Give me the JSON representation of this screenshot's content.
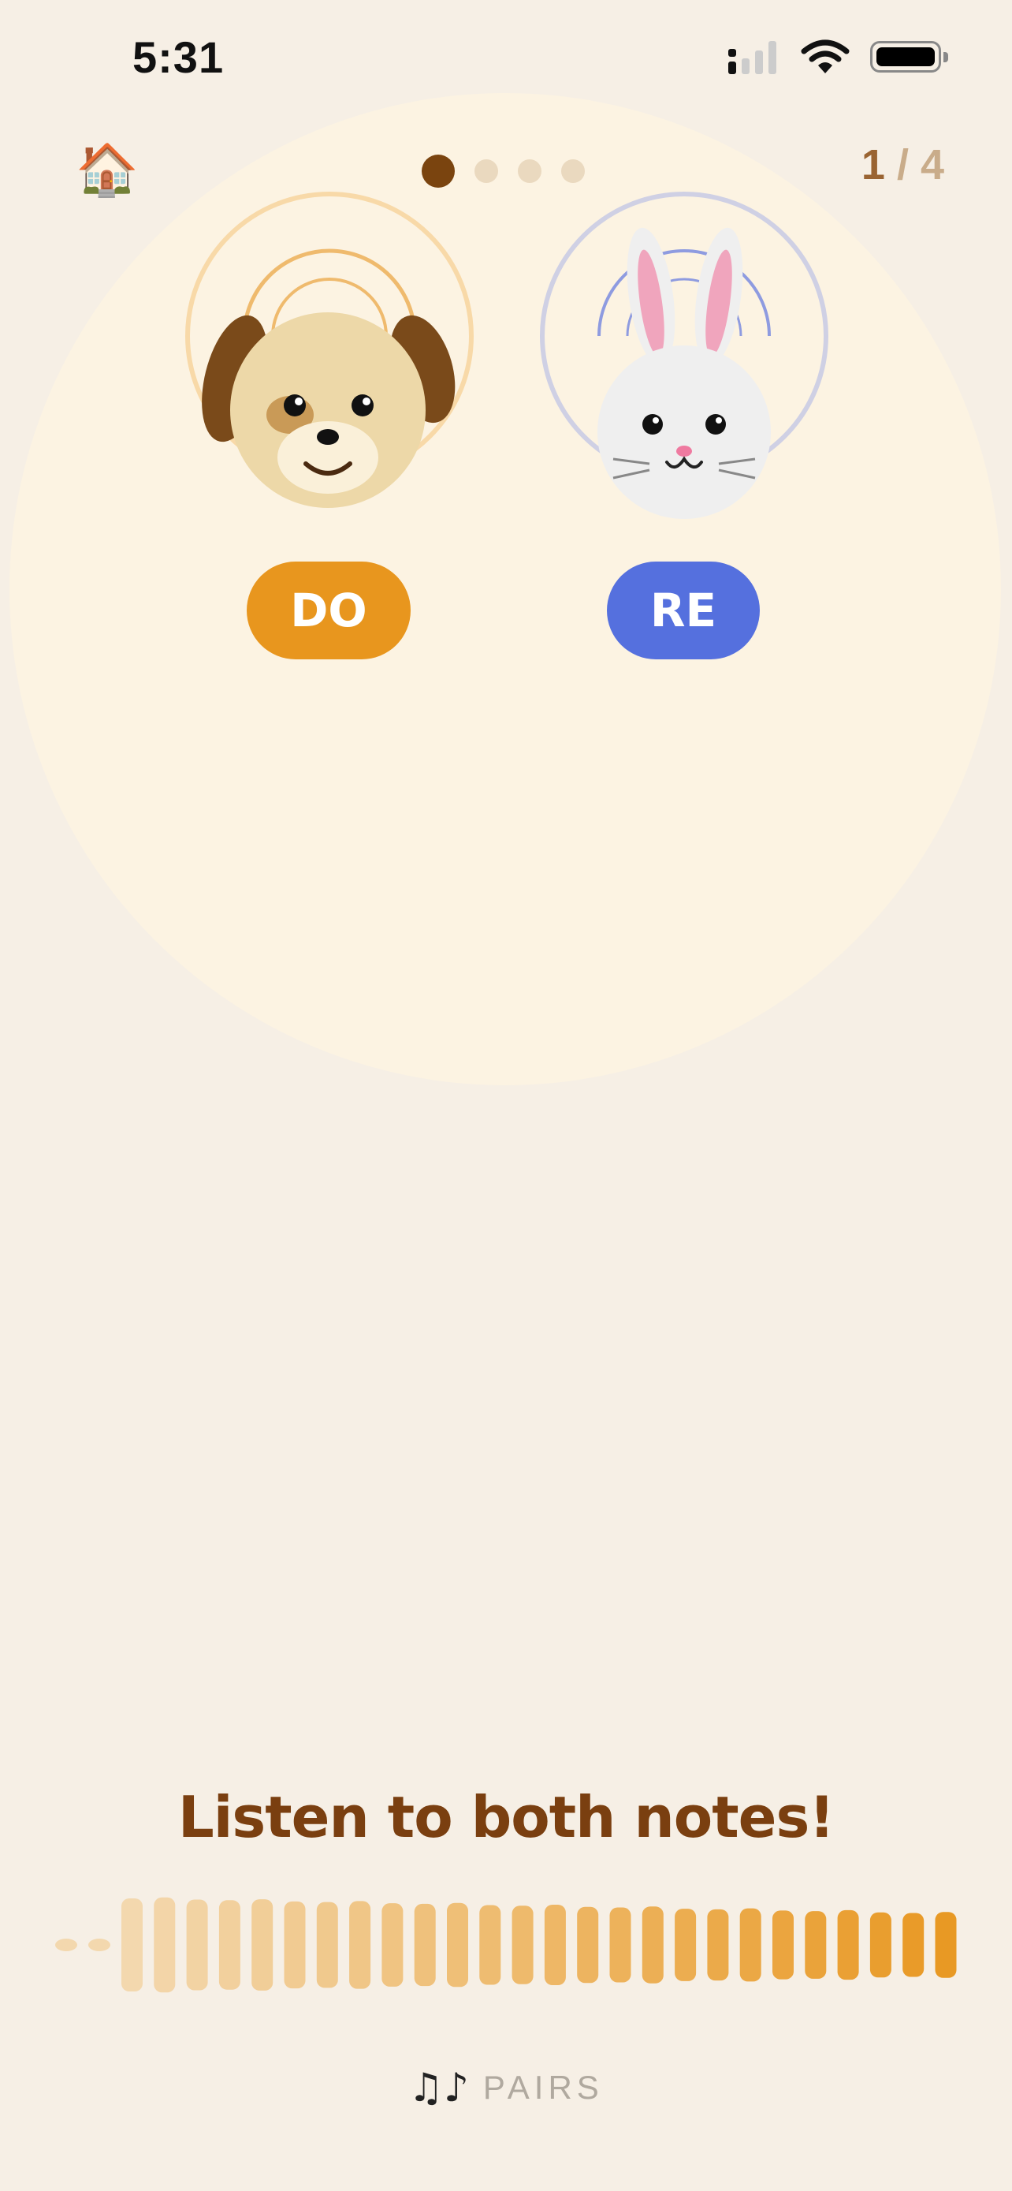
{
  "status_bar": {
    "time": "5:31"
  },
  "header": {
    "home_icon": "house-icon",
    "progress": {
      "current": 1,
      "total": 4
    },
    "counter_current": "1",
    "counter_separator": " / ",
    "counter_total": "4"
  },
  "characters": [
    {
      "name": "dog",
      "note": "DO",
      "color": "#e8961e",
      "ring_color": "#f5cf8f"
    },
    {
      "name": "bunny",
      "note": "RE",
      "color": "#5570de",
      "ring_color": "#c8c9e3"
    }
  ],
  "prompt": "Listen to both notes!",
  "waveform": {
    "played_fraction": 0.0,
    "bar_color_start": "#f3d8ae",
    "bar_color_end": "#e8961e"
  },
  "mode": {
    "icon": "music-notes-icon",
    "label": "PAIRS"
  }
}
